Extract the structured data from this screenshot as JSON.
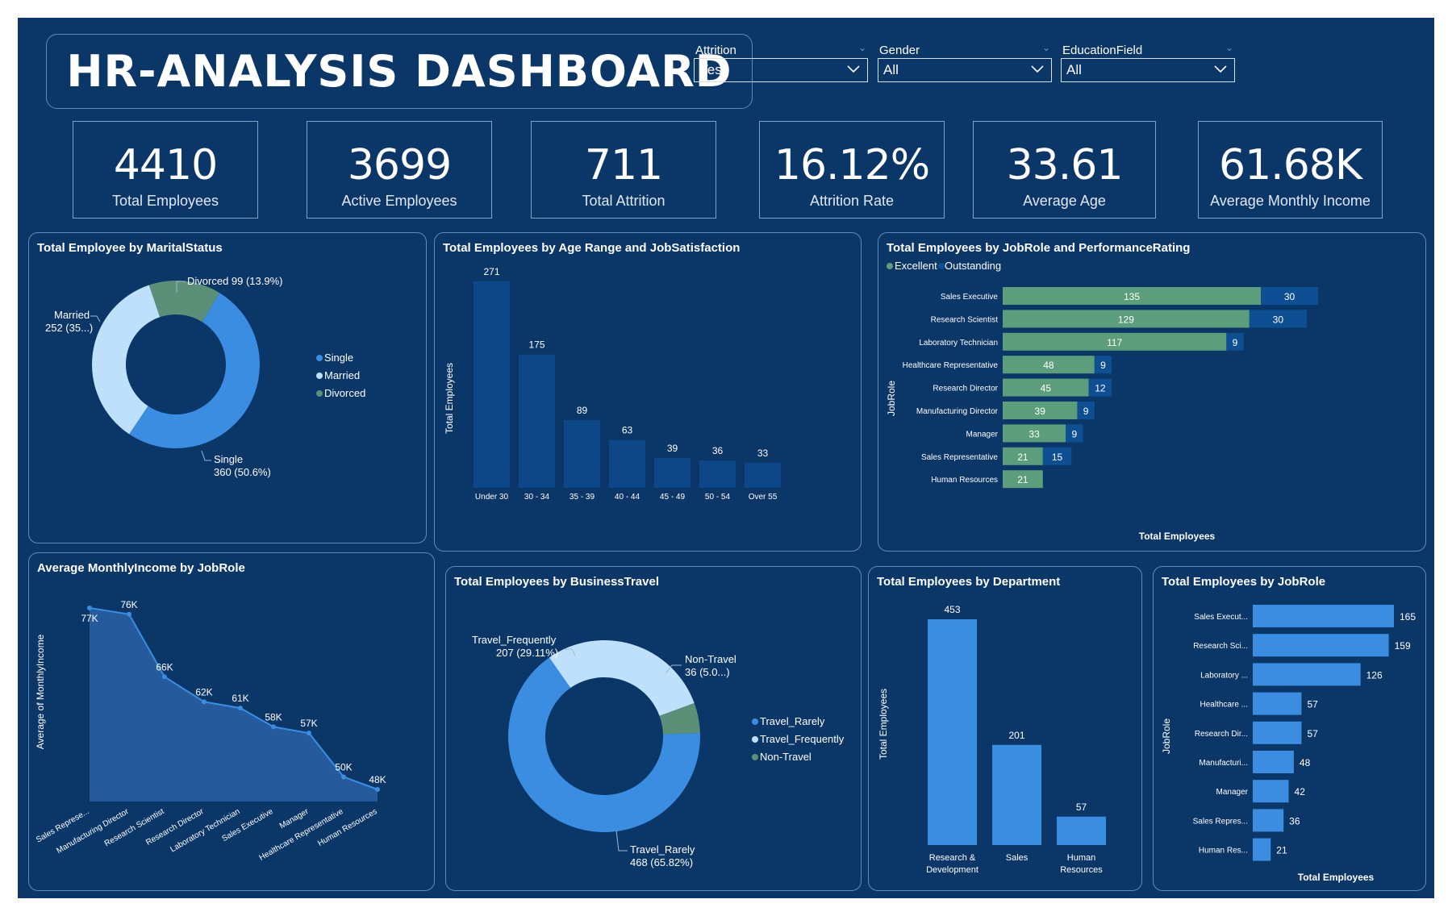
{
  "dashboard_title": "HR-ANALYSIS DASHBOARD",
  "colors": {
    "background": "#0b3668",
    "bar_dark": "#0d4787",
    "bar_blue": "#3a8de0",
    "excellent": "#5c9e7c",
    "outstanding": "#0e4f94",
    "married": "#bfe0fb",
    "divorced": "#5c8f78"
  },
  "slicers": [
    {
      "label": "Attrition",
      "value": "Yes"
    },
    {
      "label": "Gender",
      "value": "All"
    },
    {
      "label": "EducationField",
      "value": "All"
    }
  ],
  "kpis": [
    {
      "value": "4410",
      "label": "Total Employees"
    },
    {
      "value": "3699",
      "label": "Active Employees"
    },
    {
      "value": "711",
      "label": "Total Attrition"
    },
    {
      "value": "16.12%",
      "label": "Attrition Rate"
    },
    {
      "value": "33.61",
      "label": "Average Age"
    },
    {
      "value": "61.68K",
      "label": "Average Monthly Income"
    }
  ],
  "panels": {
    "marital": {
      "title": "Total Employee by MaritalStatus"
    },
    "age": {
      "title": "Total Employees by Age Range and JobSatisfaction"
    },
    "perf": {
      "title": "Total Employees by JobRole and PerformanceRating"
    },
    "income": {
      "title": "Average MonthlyIncome by JobRole"
    },
    "travel": {
      "title": "Total Employees by BusinessTravel"
    },
    "dept": {
      "title": "Total Employees by Department"
    },
    "jobrole": {
      "title": "Total Employees by JobRole"
    }
  },
  "chart_data": [
    {
      "id": "marital",
      "type": "pie",
      "donut": true,
      "title": "Total Employee by MaritalStatus",
      "slices": [
        {
          "name": "Single",
          "value": 360,
          "label": "360 (50.6%)",
          "color": "#3a8de0"
        },
        {
          "name": "Married",
          "value": 252,
          "label": "252 (35...)",
          "color": "#bfe0fb"
        },
        {
          "name": "Divorced",
          "value": 99,
          "label": "Divorced 99 (13.9%)",
          "color": "#5c8f78"
        }
      ],
      "legend": [
        "Single",
        "Married",
        "Divorced"
      ],
      "legend_position": "right"
    },
    {
      "id": "age",
      "type": "bar",
      "title": "Total Employees by Age Range and JobSatisfaction",
      "categories": [
        "Under 30",
        "30 - 34",
        "35 - 39",
        "40 - 44",
        "45 - 49",
        "50 - 54",
        "Over 55"
      ],
      "values": [
        271,
        175,
        89,
        63,
        39,
        36,
        33
      ],
      "ylabel": "Total Employees",
      "xlabel": ""
    },
    {
      "id": "perf",
      "type": "bar",
      "orientation": "horizontal",
      "stacked": true,
      "title": "Total Employees by JobRole and PerformanceRating",
      "categories": [
        "Sales Executive",
        "Research Scientist",
        "Laboratory Technician",
        "Healthcare Representative",
        "Research Director",
        "Manufacturing Director",
        "Manager",
        "Sales Representative",
        "Human Resources"
      ],
      "series": [
        {
          "name": "Excellent",
          "values": [
            135,
            129,
            117,
            48,
            45,
            39,
            33,
            21,
            21
          ]
        },
        {
          "name": "Outstanding",
          "values": [
            30,
            30,
            9,
            9,
            12,
            9,
            9,
            15,
            null
          ]
        }
      ],
      "xlabel": "Total Employees",
      "ylabel": "JobRole",
      "legend_position": "top-left"
    },
    {
      "id": "income",
      "type": "area",
      "title": "Average MonthlyIncome by JobRole",
      "categories": [
        "Sales Represe...",
        "Manufacturing Director",
        "Research Scientist",
        "Research Director",
        "Laboratory Technician",
        "Sales Executive",
        "Manager",
        "Healthcare Representative",
        "Human Resources"
      ],
      "values": [
        77,
        76,
        66,
        62,
        61,
        58,
        57,
        50,
        48
      ],
      "value_labels": [
        "77K",
        "76K",
        "66K",
        "62K",
        "61K",
        "58K",
        "57K",
        "50K",
        "48K"
      ],
      "ylabel": "Average of MonthlyIncome",
      "xlabel": ""
    },
    {
      "id": "travel",
      "type": "pie",
      "donut": true,
      "title": "Total Employees by BusinessTravel",
      "slices": [
        {
          "name": "Travel_Rarely",
          "value": 468,
          "label": "468 (65.82%)",
          "color": "#3a8de0"
        },
        {
          "name": "Travel_Frequently",
          "value": 207,
          "label": "207 (29.11%)",
          "color": "#bfe0fb"
        },
        {
          "name": "Non-Travel",
          "value": 36,
          "label": "36 (5.0...)",
          "color": "#5c8f78"
        }
      ],
      "legend": [
        "Travel_Rarely",
        "Travel_Frequently",
        "Non-Travel"
      ],
      "legend_position": "right"
    },
    {
      "id": "dept",
      "type": "bar",
      "title": "Total Employees by Department",
      "categories": [
        "Research & Development",
        "Sales",
        "Human Resources"
      ],
      "values": [
        453,
        201,
        57
      ],
      "ylabel": "Total Employees",
      "xlabel": ""
    },
    {
      "id": "jobrole",
      "type": "bar",
      "orientation": "horizontal",
      "title": "Total Employees by JobRole",
      "categories": [
        "Sales Execut...",
        "Research Sci...",
        "Laboratory ...",
        "Healthcare ...",
        "Research Dir...",
        "Manufacturi...",
        "Manager",
        "Sales Repres...",
        "Human Res..."
      ],
      "values": [
        165,
        159,
        126,
        57,
        57,
        48,
        42,
        36,
        21
      ],
      "xlabel": "Total Employees",
      "ylabel": "JobRole"
    }
  ]
}
